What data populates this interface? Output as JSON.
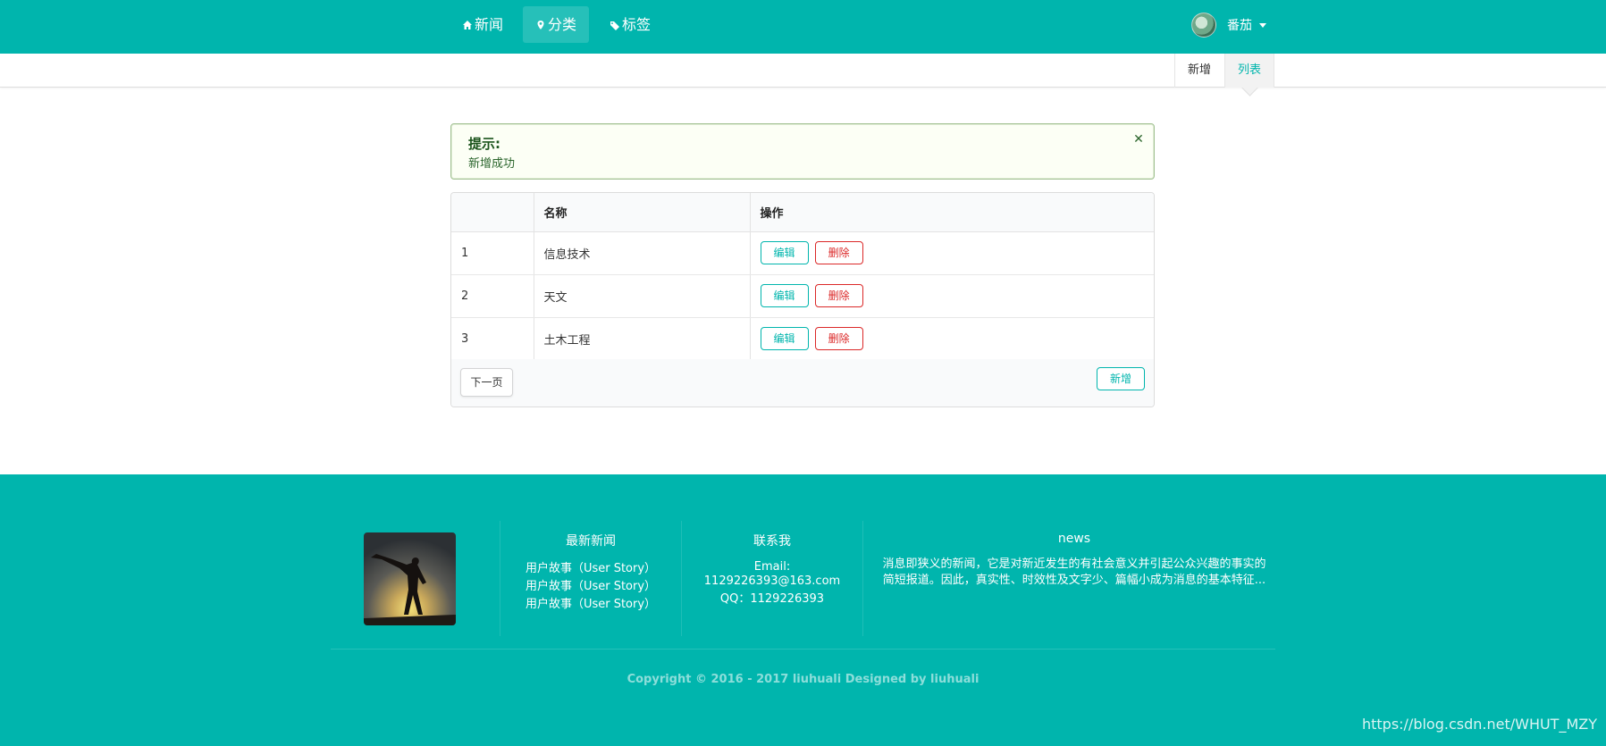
{
  "nav": {
    "items": [
      {
        "label": "新闻",
        "icon": "home-icon"
      },
      {
        "label": "分类",
        "icon": "map-pin-icon"
      },
      {
        "label": "标签",
        "icon": "tags-icon"
      }
    ],
    "user_name": "番茄"
  },
  "submenu": {
    "add_label": "新增",
    "list_label": "列表"
  },
  "message": {
    "title": "提示:",
    "body": "新增成功"
  },
  "table": {
    "headers": [
      "",
      "名称",
      "操作"
    ],
    "rows": [
      {
        "id": "1",
        "name": "信息技术"
      },
      {
        "id": "2",
        "name": "天文"
      },
      {
        "id": "3",
        "name": "土木工程"
      }
    ],
    "edit_label": "编辑",
    "delete_label": "删除",
    "next_page_label": "下一页",
    "add_label": "新增"
  },
  "footer": {
    "latest_news_title": "最新新闻",
    "latest_news": [
      "用户故事（User Story）",
      "用户故事（User Story）",
      "用户故事（User Story）"
    ],
    "contact_title": "联系我",
    "email_label": "Email:",
    "email": "1129226393@163.com",
    "qq": "QQ：1129226393",
    "news_title": "news",
    "news_text": "消息即狭义的新闻，它是对新近发生的有社会意义并引起公众兴趣的事实的简短报道。因此，真实性、时效性及文字少、篇幅小成为消息的基本特征...",
    "copyright": "Copyright © 2016 - 2017 liuhuali Designed by liuhuali"
  },
  "watermark": "https://blog.csdn.net/WHUT_MZY",
  "colors": {
    "primary": "#00b5ad",
    "danger": "#db2828",
    "success_bg": "#fcfff5",
    "success_text": "#2c662d"
  }
}
